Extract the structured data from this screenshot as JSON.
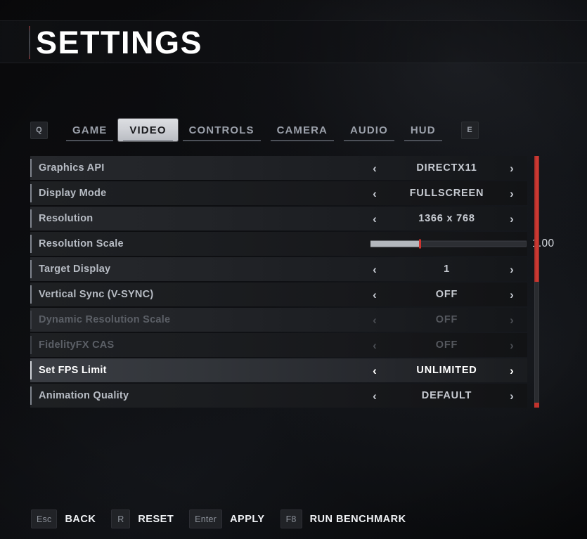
{
  "header": {
    "title": "SETTINGS"
  },
  "tabbar": {
    "prev_key": "Q",
    "next_key": "E",
    "tabs": [
      {
        "label": "GAME",
        "selected": false
      },
      {
        "label": "VIDEO",
        "selected": true
      },
      {
        "label": "CONTROLS",
        "selected": false
      },
      {
        "label": "CAMERA",
        "selected": false
      },
      {
        "label": "AUDIO",
        "selected": false
      },
      {
        "label": "HUD",
        "selected": false
      }
    ]
  },
  "settings": {
    "rows": [
      {
        "label": "Graphics API",
        "value": "DIRECTX11",
        "type": "stepper",
        "disabled": false,
        "focused": false,
        "left_arrow": "‹",
        "right_arrow": "›"
      },
      {
        "label": "Display Mode",
        "value": "FULLSCREEN",
        "type": "stepper",
        "disabled": false,
        "focused": false,
        "left_arrow": "‹",
        "right_arrow": "›"
      },
      {
        "label": "Resolution",
        "value": "1366 x 768",
        "type": "stepper",
        "disabled": false,
        "focused": false,
        "left_arrow": "‹",
        "right_arrow": "›"
      },
      {
        "label": "Resolution Scale",
        "value": "1.00",
        "type": "slider",
        "disabled": false,
        "focused": false,
        "slider_percent": 32,
        "slider_min": "0.50",
        "slider_max": "2.00"
      },
      {
        "label": "Target Display",
        "value": "1",
        "type": "stepper",
        "disabled": false,
        "focused": false,
        "left_arrow": "‹",
        "right_arrow": "›"
      },
      {
        "label": "Vertical Sync (V-SYNC)",
        "value": "OFF",
        "type": "stepper",
        "disabled": false,
        "focused": false,
        "left_arrow": "‹",
        "right_arrow": "›"
      },
      {
        "label": "Dynamic Resolution Scale",
        "value": "OFF",
        "type": "stepper",
        "disabled": true,
        "focused": false,
        "left_arrow": "‹",
        "right_arrow": "›"
      },
      {
        "label": "FidelityFX CAS",
        "value": "OFF",
        "type": "stepper",
        "disabled": true,
        "focused": false,
        "left_arrow": "‹",
        "right_arrow": "›"
      },
      {
        "label": "Set FPS Limit",
        "value": "UNLIMITED",
        "type": "stepper",
        "disabled": false,
        "focused": true,
        "left_arrow": "‹",
        "right_arrow": "›"
      },
      {
        "label": "Animation Quality",
        "value": "DEFAULT",
        "type": "stepper",
        "disabled": false,
        "focused": false,
        "left_arrow": "‹",
        "right_arrow": "›"
      }
    ]
  },
  "scrollbar": {
    "thumb_percent": 50,
    "thumb_position_percent": 0
  },
  "actionbar": {
    "actions": [
      {
        "key": "Esc",
        "label": "BACK"
      },
      {
        "key": "R",
        "label": "RESET"
      },
      {
        "key": "Enter",
        "label": "APPLY"
      },
      {
        "key": "F8",
        "label": "RUN BENCHMARK"
      }
    ]
  },
  "colors": {
    "accent_red": "#c9352f",
    "selected_tab_bg": "#cfd1d6",
    "text_primary": "#ffffff",
    "text_secondary": "#b7bcc4",
    "text_disabled": "#5b5f66"
  }
}
